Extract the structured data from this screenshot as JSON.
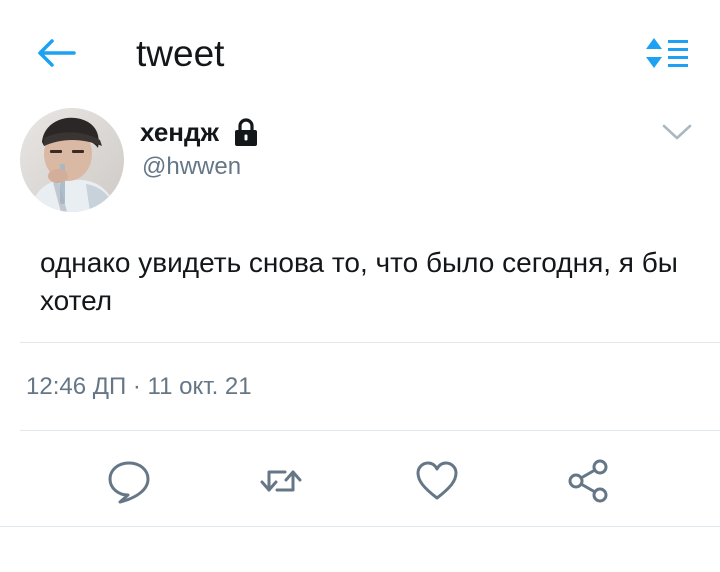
{
  "header": {
    "back_icon": "arrow-left-icon",
    "title": "tweet",
    "sort_icon": "sort-list-icon"
  },
  "author": {
    "name": "хендж",
    "handle": "@hwwen",
    "lock_icon": "lock-icon",
    "menu_icon": "chevron-down-icon"
  },
  "tweet": {
    "text": "однако увидеть снова то, что было сегодня, я бы хотел",
    "timestamp": "12:46 ДП · 11 окт. 21"
  },
  "actions": {
    "reply_icon": "reply-icon",
    "retweet_icon": "retweet-icon",
    "like_icon": "heart-icon",
    "share_icon": "share-icon"
  },
  "colors": {
    "accent": "#1da1f2",
    "text": "#14171a",
    "secondary": "#657786",
    "divider": "#e1e8ed"
  }
}
